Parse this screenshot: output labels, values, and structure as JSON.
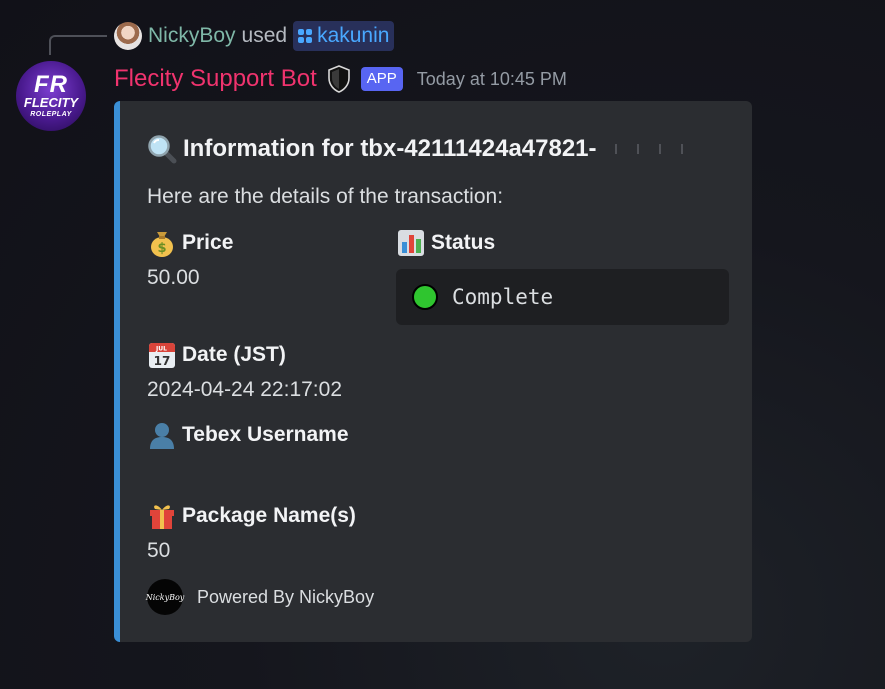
{
  "reply": {
    "user": "NickyBoy",
    "used": "used",
    "command": "kakunin"
  },
  "bot_avatar": {
    "line1": "FR",
    "line2": "FLECITY",
    "line3": "ROLEPLAY"
  },
  "header": {
    "bot_name": "Flecity Support Bot",
    "badge": "APP",
    "timestamp": "Today at 10:45 PM"
  },
  "embed": {
    "accent_color": "#3a8fd6",
    "title": "Information for tbx-42111424a47821-",
    "description": "Here are the details of the transaction:",
    "fields": {
      "price": {
        "name": "Price",
        "value": "50.00",
        "icon": "money-bag-icon"
      },
      "status": {
        "name": "Status",
        "value": "Complete",
        "icon": "bar-chart-icon",
        "indicator_color": "#2fc52f"
      },
      "date": {
        "name": "Date (JST)",
        "value": "2024-04-24 22:17:02",
        "icon": "calendar-icon",
        "calendar_month": "JUL",
        "calendar_day": "17"
      },
      "username": {
        "name": "Tebex Username",
        "value": "",
        "icon": "person-icon"
      },
      "package": {
        "name": "Package Name(s)",
        "value": "50",
        "icon": "gift-icon"
      }
    },
    "footer": {
      "text": "Powered By NickyBoy",
      "icon_text": "NickyBoy"
    }
  },
  "colors": {
    "bot_name": "#f0336e",
    "reply_user": "#7fb8a8",
    "command": "#49a8ff",
    "badge": "#5865f2"
  }
}
